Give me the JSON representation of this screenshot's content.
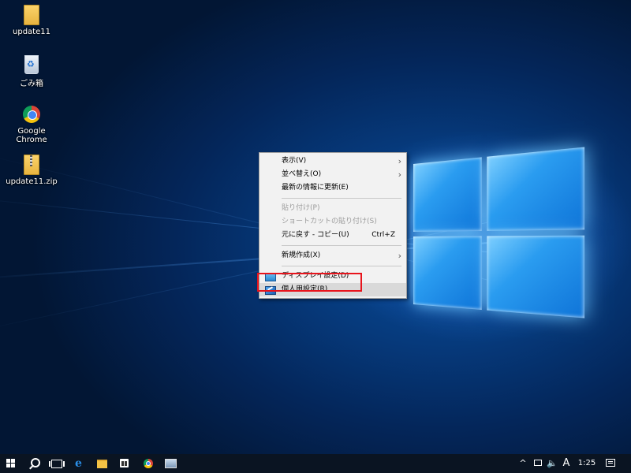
{
  "desktop": {
    "icons": [
      {
        "label": "update11",
        "icon": "folder-icon"
      },
      {
        "label": "ごみ箱",
        "icon": "recycle-bin-icon"
      },
      {
        "label": "Google Chrome",
        "icon": "chrome-icon"
      },
      {
        "label": "update11.zip",
        "icon": "zip-folder-icon"
      }
    ]
  },
  "context_menu": {
    "items": [
      {
        "label": "表示(V)",
        "submenu": true
      },
      {
        "label": "並べ替え(O)",
        "submenu": true
      },
      {
        "label": "最新の情報に更新(E)"
      },
      {
        "label": "貼り付け(P)",
        "disabled": true
      },
      {
        "label": "ショートカットの貼り付け(S)",
        "disabled": true
      },
      {
        "label": "元に戻す - コピー(U)",
        "shortcut": "Ctrl+Z"
      },
      {
        "label": "新規作成(X)",
        "submenu": true
      },
      {
        "label": "ディスプレイ設定(D)",
        "icon": "display-settings-icon"
      },
      {
        "label": "個人用設定(R)",
        "icon": "personalize-icon",
        "highlighted": true
      }
    ],
    "arrow_glyph": "›"
  },
  "annotation": {
    "color": "#e8141c"
  },
  "taskbar": {
    "apps": [
      "start-icon",
      "search-icon",
      "task-view-icon",
      "edge-icon",
      "file-explorer-icon",
      "store-icon",
      "chrome-icon",
      "remote-desktop-icon"
    ],
    "tray": {
      "chevron": "^",
      "ime": "A",
      "time": "1:25"
    }
  }
}
